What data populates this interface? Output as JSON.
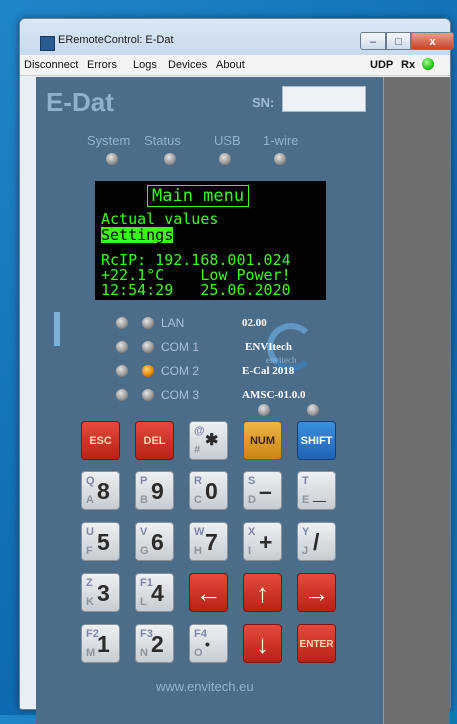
{
  "window": {
    "title": "ERemoteControl: E-Dat",
    "min": "–",
    "max": "□",
    "close": "x"
  },
  "menu": {
    "items": [
      "Disconnect",
      "Errors",
      "Logs",
      "Devices",
      "About"
    ],
    "udp": "UDP",
    "rx": "Rx",
    "rx_led_color": "#21c31a"
  },
  "device": {
    "brand": "E-Dat",
    "sn_label": "SN:",
    "sn_value": "",
    "top_leds": [
      "System",
      "Status",
      "USB",
      "1-wire"
    ],
    "display": {
      "title": "Main menu",
      "lines": [
        "Actual values",
        "Settings"
      ],
      "selected": "Settings",
      "status": [
        "RcIP: 192.168.001.024",
        "+22.1°C    Low Power!",
        "12:54:29   25.06.2020"
      ],
      "color": "#39ff14"
    },
    "ports": [
      {
        "label": "LAN",
        "active": false
      },
      {
        "label": "COM 1",
        "active": false
      },
      {
        "label": "COM 2",
        "active": true
      },
      {
        "label": "COM 3",
        "active": false
      }
    ],
    "info": [
      "02.00",
      "ENVItech",
      "E-Cal 2018",
      "AMSC-01.0.0"
    ],
    "watermark": "envitech",
    "footer": "www.envitech.eu"
  },
  "keypad": {
    "row1": [
      "ESC",
      "DEL",
      "",
      "NUM",
      "SHIFT"
    ],
    "symbol_key": {
      "top": "@",
      "main": "✱",
      "bottom": "#"
    },
    "digit_keys": [
      {
        "top": "Q",
        "main": "8",
        "bottom": "A"
      },
      {
        "top": "P",
        "main": "9",
        "bottom": "B"
      },
      {
        "top": "R",
        "main": "0",
        "bottom": "C"
      },
      {
        "top": "S",
        "main": "–",
        "bottom": "D"
      },
      {
        "top": "T",
        "main": "_",
        "bottom": "E"
      },
      {
        "top": "U",
        "main": "5",
        "bottom": "F"
      },
      {
        "top": "V",
        "main": "6",
        "bottom": "G"
      },
      {
        "top": "W",
        "main": "7",
        "bottom": "H"
      },
      {
        "top": "X",
        "main": "+",
        "bottom": "I"
      },
      {
        "top": "Y",
        "main": "/",
        "bottom": "J"
      },
      {
        "top": "Z",
        "main": "3",
        "bottom": "K"
      },
      {
        "top": "F1",
        "main": "4",
        "bottom": "L"
      },
      {
        "top": "F2",
        "main": "1",
        "bottom": "M"
      },
      {
        "top": "F3",
        "main": "2",
        "bottom": "N"
      },
      {
        "top": "F4",
        "main": "•",
        "bottom": "O"
      }
    ],
    "arrows": {
      "left": "←",
      "up": "↑",
      "right": "→",
      "down": "↓"
    },
    "enter": "ENTER"
  }
}
